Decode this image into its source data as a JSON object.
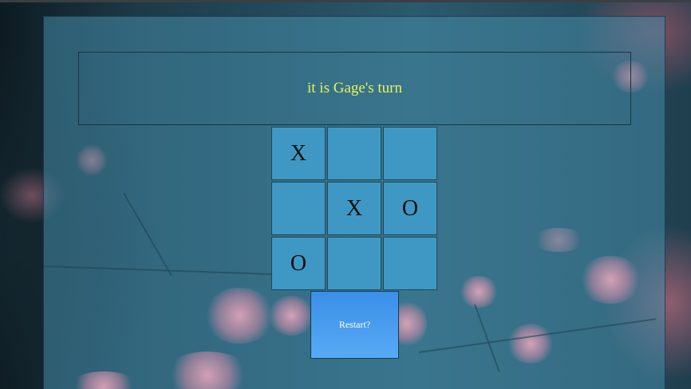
{
  "status": {
    "message": "it is Gage's turn"
  },
  "board": {
    "cells": [
      "X",
      "",
      "",
      "",
      "X",
      "O",
      "O",
      "",
      ""
    ]
  },
  "controls": {
    "restart_label": "Restart?"
  },
  "colors": {
    "status_text": "#e6f25a",
    "cell_background": "#3f98c3",
    "restart_button": "#4a9ef0"
  }
}
